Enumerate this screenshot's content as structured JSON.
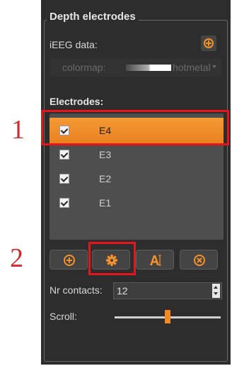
{
  "group_title": "Depth electrodes",
  "ieeg_label": "iEEG data:",
  "colormap": {
    "label": "colormap:",
    "value": "hotmetal"
  },
  "electrodes_label": "Electrodes:",
  "electrodes": [
    {
      "name": "E4",
      "checked": true,
      "selected": true
    },
    {
      "name": "E3",
      "checked": true,
      "selected": false
    },
    {
      "name": "E2",
      "checked": true,
      "selected": false
    },
    {
      "name": "E1",
      "checked": true,
      "selected": false
    }
  ],
  "toolbar": {
    "add_icon": "plus-circle-icon",
    "settings_icon": "gear-icon",
    "rename_icon": "text-cursor-icon",
    "remove_icon": "x-circle-icon"
  },
  "nr_contacts": {
    "label": "Nr contacts:",
    "value": "12"
  },
  "scroll": {
    "label": "Scroll:",
    "position_fraction": 0.48
  },
  "annotations": {
    "one": "1",
    "two": "2"
  },
  "colors": {
    "accent": "#f28a22",
    "panel_bg": "#2d2d2d",
    "annotation_red": "#e8141c"
  }
}
